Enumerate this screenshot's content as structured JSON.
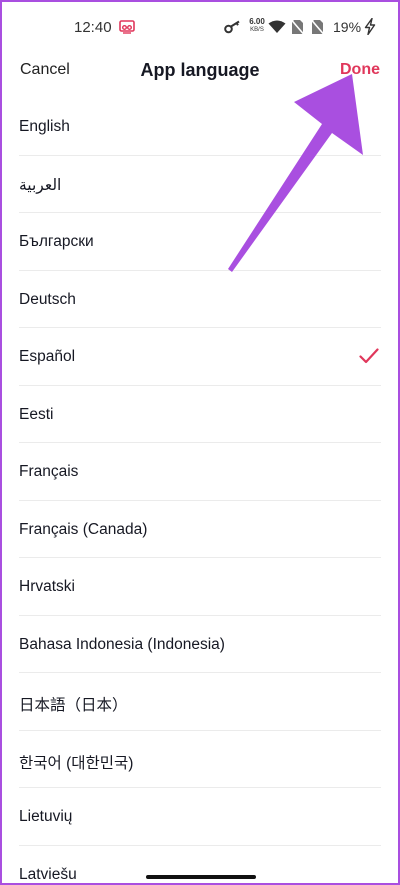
{
  "status_bar": {
    "time": "12:40",
    "net_speed_value": "6.00",
    "net_speed_unit": "KB/S",
    "battery": "19%"
  },
  "header": {
    "cancel_label": "Cancel",
    "title": "App language",
    "done_label": "Done"
  },
  "languages": [
    {
      "label": "English"
    },
    {
      "label": "العربية"
    },
    {
      "label": "Български"
    },
    {
      "label": "Deutsch"
    },
    {
      "label": "Español",
      "selected": true
    },
    {
      "label": "Eesti"
    },
    {
      "label": "Français"
    },
    {
      "label": "Français (Canada)"
    },
    {
      "label": "Hrvatski"
    },
    {
      "label": "Bahasa Indonesia (Indonesia)"
    },
    {
      "label": "日本語（日本）"
    },
    {
      "label": "한국어 (대한민국)"
    },
    {
      "label": "Lietuvių"
    },
    {
      "label": "Latviešu"
    }
  ],
  "colors": {
    "accent": "#e0375b",
    "annotation_arrow": "#a94fe0",
    "frame_border": "#a94fe0"
  },
  "icons": {
    "cast": "screen-cast-icon",
    "key": "vpn-key-icon",
    "wifi": "wifi-icon",
    "sim": "no-sim-icon",
    "charging": "charging-bolt-icon",
    "check": "checkmark-icon"
  }
}
